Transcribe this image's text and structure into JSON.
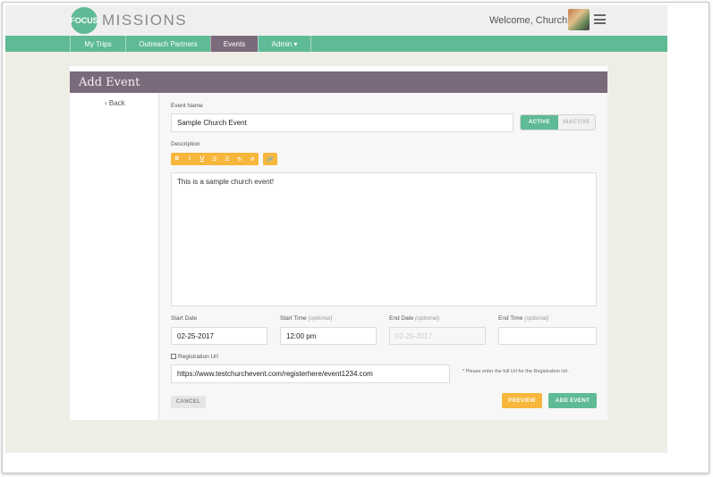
{
  "header": {
    "logo_mark": "FOCUS",
    "logo_text": "MISSIONS",
    "welcome": "Welcome, Church!"
  },
  "nav": {
    "items": [
      {
        "label": "My Trips"
      },
      {
        "label": "Outreach Partners"
      },
      {
        "label": "Events"
      },
      {
        "label": "Admin ▾"
      }
    ],
    "active": "Events"
  },
  "page": {
    "title": "Add Event",
    "back_label": "‹ Back"
  },
  "form": {
    "event_name_label": "Event Name",
    "event_name_value": "Sample Church Event",
    "status_active": "ACTIVE",
    "status_inactive": "INACTIVE",
    "description_label": "Description",
    "toolbar_buttons": [
      "B",
      "I",
      "U",
      "☰",
      "☰",
      "↻",
      "↺"
    ],
    "toolbar_link": "🔗",
    "description_value": "This is a sample church event!",
    "start_date_label": "Start Date",
    "start_date_value": "02-25-2017",
    "start_time_label": "Start Time",
    "start_time_hint": "(optional)",
    "start_time_value": "12:00 pm",
    "end_date_label": "End Date",
    "end_date_hint": "(optional)",
    "end_date_placeholder": "02-25-2017",
    "end_time_label": "End Time",
    "end_time_hint": "(optional)",
    "registration_label": "Registration Url",
    "registration_value": "https://www.testchurchevent.com/registerhere/event1234.com",
    "registration_note": "* Please enter the full Url for the Registration Url."
  },
  "actions": {
    "cancel": "CANCEL",
    "preview": "PREVIEW",
    "add_event": "ADD EVENT"
  },
  "colors": {
    "brand_green": "#5fba96",
    "title_purple": "#7b6a7b",
    "accent_orange": "#f6b73c"
  }
}
